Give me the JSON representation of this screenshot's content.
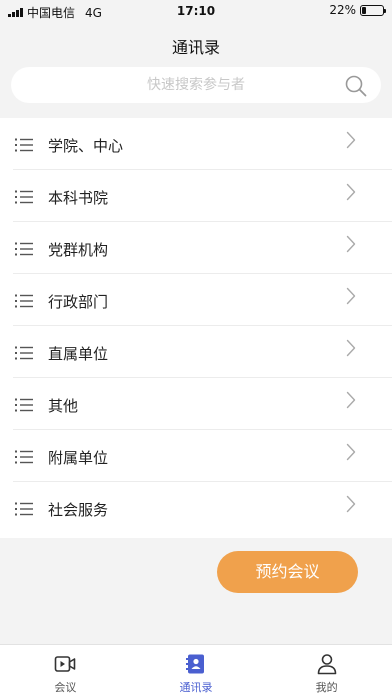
{
  "status_bar": {
    "carrier": "中国电信",
    "network": "4G",
    "time": "17:10",
    "battery": "22%",
    "battery_level": 0.22
  },
  "header": {
    "title": "通讯录"
  },
  "search": {
    "placeholder": "快速搜索参与者",
    "value": ""
  },
  "directory": {
    "items": [
      {
        "label": "学院、中心"
      },
      {
        "label": "本科书院"
      },
      {
        "label": "党群机构"
      },
      {
        "label": "行政部门"
      },
      {
        "label": "直属单位"
      },
      {
        "label": "其他"
      },
      {
        "label": "附属单位"
      },
      {
        "label": "社会服务"
      }
    ]
  },
  "actions": {
    "book_meeting": "预约会议"
  },
  "tab_bar": {
    "tabs": [
      {
        "label": "会议",
        "icon": "video-meeting-icon"
      },
      {
        "label": "通讯录",
        "icon": "contacts-icon"
      },
      {
        "label": "我的",
        "icon": "user-profile-icon"
      }
    ],
    "active_index": 1
  },
  "colors": {
    "accent": "#4a5fd0",
    "button": "#f0a14c",
    "background": "#f3f3f3"
  }
}
